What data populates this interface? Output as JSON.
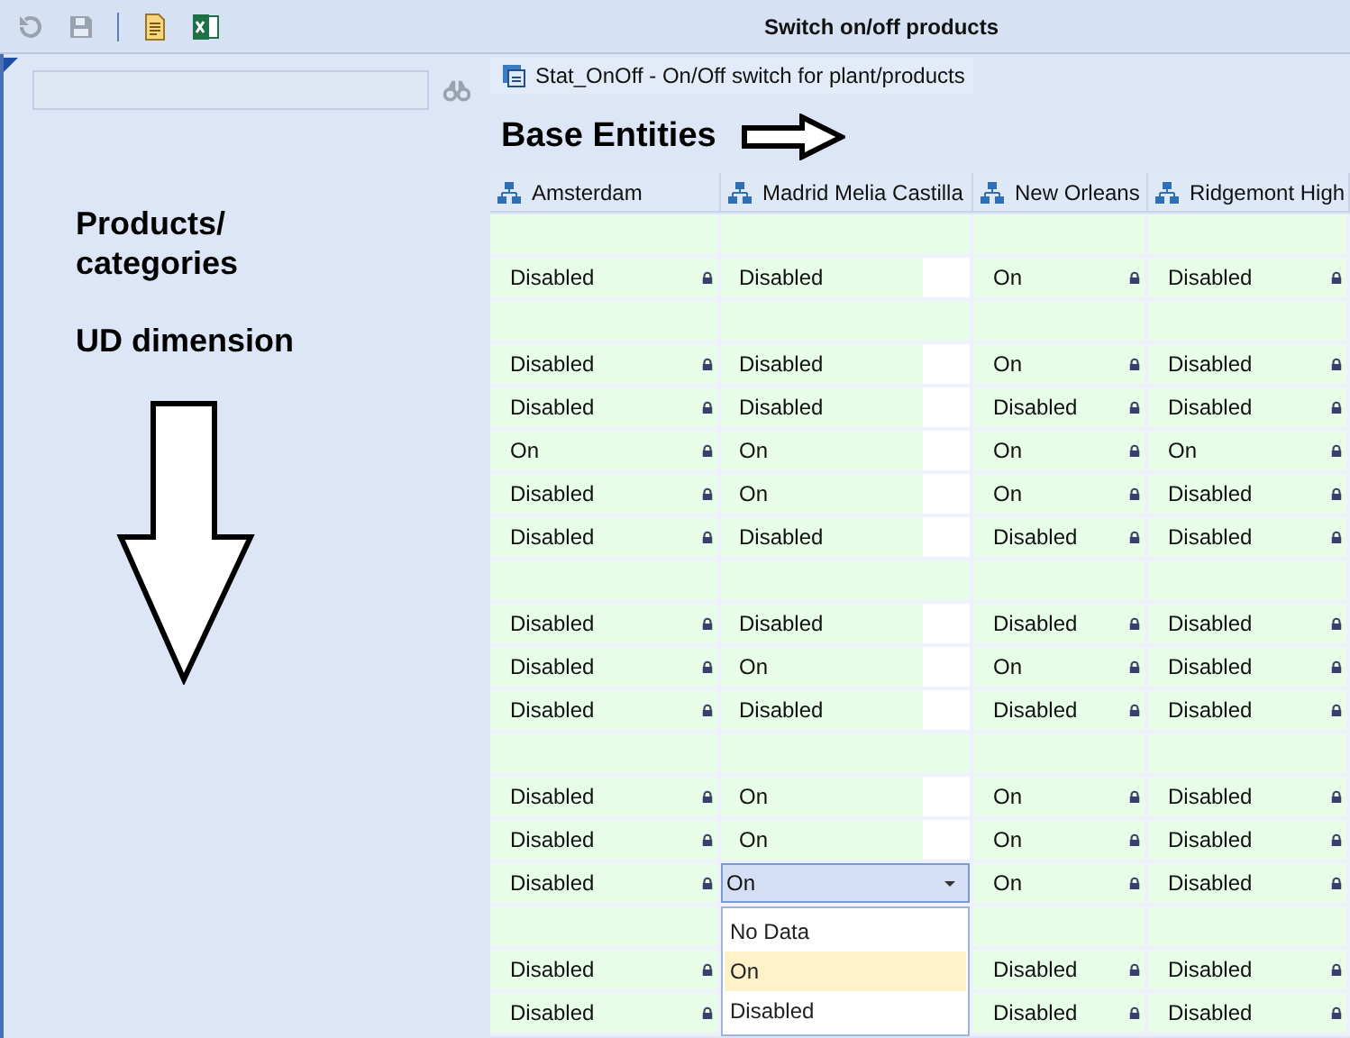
{
  "window": {
    "title": "Switch on/off products"
  },
  "form": {
    "title": "Stat_OnOff - On/Off switch for plant/products"
  },
  "annotations": {
    "rows_label": "Products/ categories",
    "dimension_label": "UD dimension",
    "columns_label": "Base Entities"
  },
  "columns": [
    {
      "label": "Amsterdam",
      "locked": true
    },
    {
      "label": "Madrid Melia Castilla",
      "locked": false
    },
    {
      "label": "New Orleans",
      "locked": true
    },
    {
      "label": "Ridgemont High",
      "locked": true
    }
  ],
  "rows": [
    {
      "kind": "blank"
    },
    {
      "kind": "data",
      "editing": false,
      "cells": [
        "Disabled",
        "Disabled",
        "On",
        "Disabled"
      ]
    },
    {
      "kind": "blank"
    },
    {
      "kind": "data",
      "editing": false,
      "cells": [
        "Disabled",
        "Disabled",
        "On",
        "Disabled"
      ]
    },
    {
      "kind": "data",
      "editing": false,
      "cells": [
        "Disabled",
        "Disabled",
        "Disabled",
        "Disabled"
      ]
    },
    {
      "kind": "data",
      "editing": false,
      "cells": [
        "On",
        "On",
        "On",
        "On"
      ]
    },
    {
      "kind": "data",
      "editing": false,
      "cells": [
        "Disabled",
        "On",
        "On",
        "Disabled"
      ]
    },
    {
      "kind": "data",
      "editing": false,
      "cells": [
        "Disabled",
        "Disabled",
        "Disabled",
        "Disabled"
      ]
    },
    {
      "kind": "blank"
    },
    {
      "kind": "data",
      "editing": false,
      "cells": [
        "Disabled",
        "Disabled",
        "Disabled",
        "Disabled"
      ]
    },
    {
      "kind": "data",
      "editing": false,
      "cells": [
        "Disabled",
        "On",
        "On",
        "Disabled"
      ]
    },
    {
      "kind": "data",
      "editing": false,
      "cells": [
        "Disabled",
        "Disabled",
        "Disabled",
        "Disabled"
      ]
    },
    {
      "kind": "blank"
    },
    {
      "kind": "data",
      "editing": false,
      "cells": [
        "Disabled",
        "On",
        "On",
        "Disabled"
      ]
    },
    {
      "kind": "data",
      "editing": false,
      "cells": [
        "Disabled",
        "On",
        "On",
        "Disabled"
      ]
    },
    {
      "kind": "data",
      "editing": true,
      "cells": [
        "Disabled",
        "On",
        "On",
        "Disabled"
      ]
    },
    {
      "kind": "blank"
    },
    {
      "kind": "data",
      "cells": [
        "Disabled",
        null,
        "Disabled",
        "Disabled"
      ]
    },
    {
      "kind": "data",
      "cells": [
        "Disabled",
        null,
        "Disabled",
        "Disabled"
      ]
    }
  ],
  "dropdown": {
    "options": [
      {
        "label": "No Data",
        "selected": false
      },
      {
        "label": "On",
        "selected": true
      },
      {
        "label": "Disabled",
        "selected": false
      }
    ]
  }
}
